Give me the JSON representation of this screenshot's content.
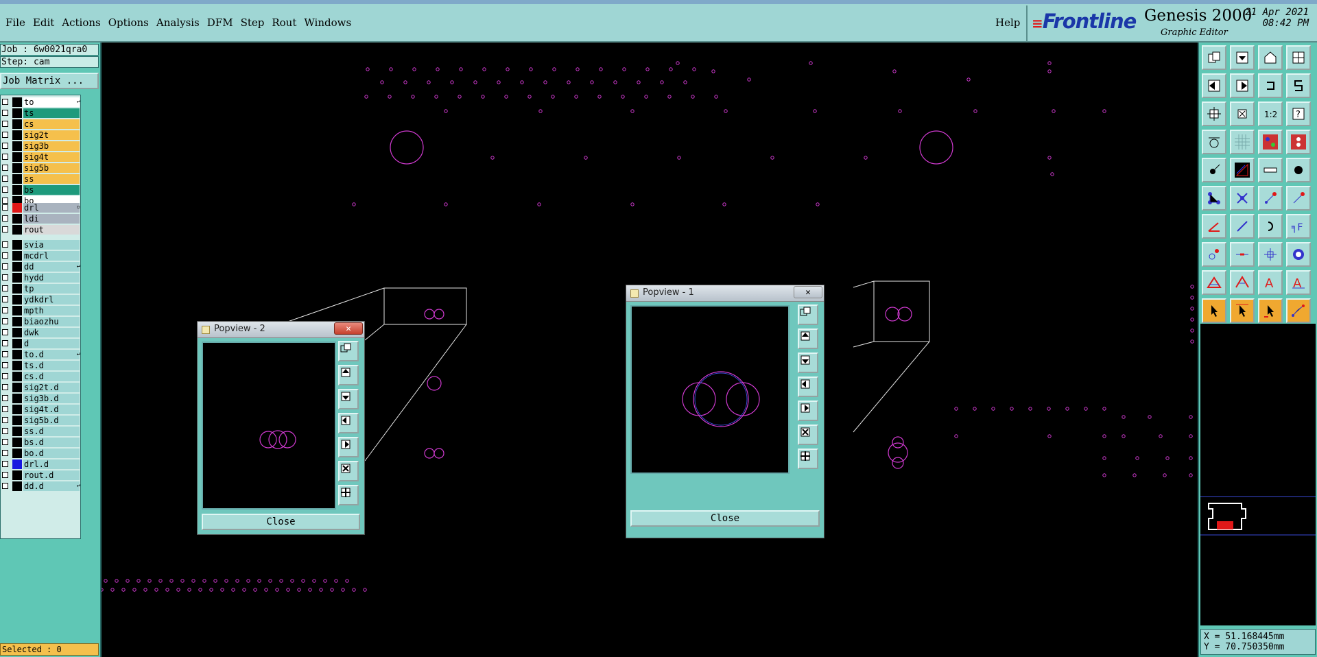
{
  "menubar": {
    "menus": [
      "File",
      "Edit",
      "Actions",
      "Options",
      "Analysis",
      "DFM",
      "Step",
      "Rout",
      "Windows"
    ],
    "help": "Help",
    "brand": "Frontline",
    "product": "Genesis 2000",
    "subtitle": "Graphic Editor",
    "date": "21 Apr 2021",
    "time": "08:42 PM"
  },
  "job": {
    "job_line": "Job : 6w0021qra0",
    "step_line": "Step: cam",
    "matrix_button": "Job Matrix ..."
  },
  "layers": [
    {
      "name": "to",
      "bg": "#ffffff",
      "swatch": "#000000",
      "flag": "↵"
    },
    {
      "name": "ts",
      "bg": "#1e9a7c",
      "swatch": "#000000",
      "flag": ""
    },
    {
      "name": "cs",
      "bg": "#f5c04c",
      "swatch": "#000000",
      "flag": ""
    },
    {
      "name": "sig2t",
      "bg": "#f5c04c",
      "swatch": "#000000",
      "flag": ""
    },
    {
      "name": "sig3b",
      "bg": "#f5c04c",
      "swatch": "#000000",
      "flag": ""
    },
    {
      "name": "sig4t",
      "bg": "#f5c04c",
      "swatch": "#000000",
      "flag": ""
    },
    {
      "name": "sig5b",
      "bg": "#f5c04c",
      "swatch": "#000000",
      "flag": ""
    },
    {
      "name": "ss",
      "bg": "#f5c04c",
      "swatch": "#000000",
      "flag": ""
    },
    {
      "name": "bs",
      "bg": "#1e9a7c",
      "swatch": "#000000",
      "flag": ""
    },
    {
      "name": "bo",
      "bg": "#ffffff",
      "swatch": "#000000",
      "flag": ""
    },
    {
      "name": "drl",
      "bg": "#a9b3bf",
      "swatch": "#e01818",
      "flag": "▫"
    },
    {
      "name": "ldi",
      "bg": "#a9b3bf",
      "swatch": "#000000",
      "flag": ""
    },
    {
      "name": "rout",
      "bg": "#d9d9d9",
      "swatch": "#000000",
      "flag": ""
    },
    {
      "name": "svia",
      "bg": "#9fd6d4",
      "swatch": "#000000",
      "flag": ""
    },
    {
      "name": "mcdrl",
      "bg": "#9fd6d4",
      "swatch": "#000000",
      "flag": ""
    },
    {
      "name": "dd",
      "bg": "#9fd6d4",
      "swatch": "#000000",
      "flag": "↵"
    },
    {
      "name": "hydd",
      "bg": "#9fd6d4",
      "swatch": "#000000",
      "flag": ""
    },
    {
      "name": "tp",
      "bg": "#9fd6d4",
      "swatch": "#000000",
      "flag": ""
    },
    {
      "name": "ydkdrl",
      "bg": "#9fd6d4",
      "swatch": "#000000",
      "flag": ""
    },
    {
      "name": "mpth",
      "bg": "#9fd6d4",
      "swatch": "#000000",
      "flag": ""
    },
    {
      "name": "biaozhu",
      "bg": "#9fd6d4",
      "swatch": "#000000",
      "flag": ""
    },
    {
      "name": "dwk",
      "bg": "#9fd6d4",
      "swatch": "#000000",
      "flag": ""
    },
    {
      "name": "d",
      "bg": "#9fd6d4",
      "swatch": "#000000",
      "flag": ""
    },
    {
      "name": "to.d",
      "bg": "#9fd6d4",
      "swatch": "#000000",
      "flag": "↵"
    },
    {
      "name": "ts.d",
      "bg": "#9fd6d4",
      "swatch": "#000000",
      "flag": ""
    },
    {
      "name": "cs.d",
      "bg": "#9fd6d4",
      "swatch": "#000000",
      "flag": ""
    },
    {
      "name": "sig2t.d",
      "bg": "#9fd6d4",
      "swatch": "#000000",
      "flag": ""
    },
    {
      "name": "sig3b.d",
      "bg": "#9fd6d4",
      "swatch": "#000000",
      "flag": ""
    },
    {
      "name": "sig4t.d",
      "bg": "#9fd6d4",
      "swatch": "#000000",
      "flag": ""
    },
    {
      "name": "sig5b.d",
      "bg": "#9fd6d4",
      "swatch": "#000000",
      "flag": ""
    },
    {
      "name": "ss.d",
      "bg": "#9fd6d4",
      "swatch": "#000000",
      "flag": ""
    },
    {
      "name": "bs.d",
      "bg": "#9fd6d4",
      "swatch": "#000000",
      "flag": ""
    },
    {
      "name": "bo.d",
      "bg": "#9fd6d4",
      "swatch": "#000000",
      "flag": ""
    },
    {
      "name": "drl.d",
      "bg": "#9fd6d4",
      "swatch": "#1818e0",
      "flag": ""
    },
    {
      "name": "rout.d",
      "bg": "#9fd6d4",
      "swatch": "#000000",
      "flag": ""
    },
    {
      "name": "dd.d",
      "bg": "#9fd6d4",
      "swatch": "#000000",
      "flag": "↵"
    }
  ],
  "status": {
    "selected": "Selected : 0",
    "x_coord": "X = 51.168445mm",
    "y_coord": "Y = 70.750350mm"
  },
  "tools": [
    "copy-icon",
    "move-icon",
    "home-icon",
    "window-icon",
    "arrow-left-icon",
    "arrow-right-icon",
    "undo-icon",
    "redo-icon",
    "fit-icon",
    "zoom-icon",
    "scale-icon",
    "help-icon",
    "measure-icon",
    "grid-icon",
    "snap-icon",
    "layers-icon",
    "pad-icon",
    "polygon-icon",
    "ruler-icon",
    "dot-icon",
    "connect-icon",
    "cross-icon",
    "line-icon",
    "arc-icon",
    "angle-icon",
    "slash-icon",
    "rotate-icon",
    "text-icon",
    "node-icon",
    "segment-icon",
    "split-icon",
    "group-icon",
    "triangle-icon",
    "peak-icon",
    "letter-a-icon",
    "letter-a2-icon",
    "pointer-icon",
    "pointer-select-icon",
    "pointer-move-icon",
    "pointer-net-icon"
  ],
  "popviews": [
    {
      "title": "Popview - 2",
      "close_label": "Close",
      "close_x": "✕"
    },
    {
      "title": "Popview - 1",
      "close_label": "Close",
      "close_x": "✕"
    }
  ],
  "colors": {
    "panel_teal": "#5fc7b5",
    "menubar": "#9fd6d4",
    "pad_magenta": "#d13ad1",
    "brand_blue": "#1a37a8",
    "selected_orange": "#f5c04c"
  }
}
